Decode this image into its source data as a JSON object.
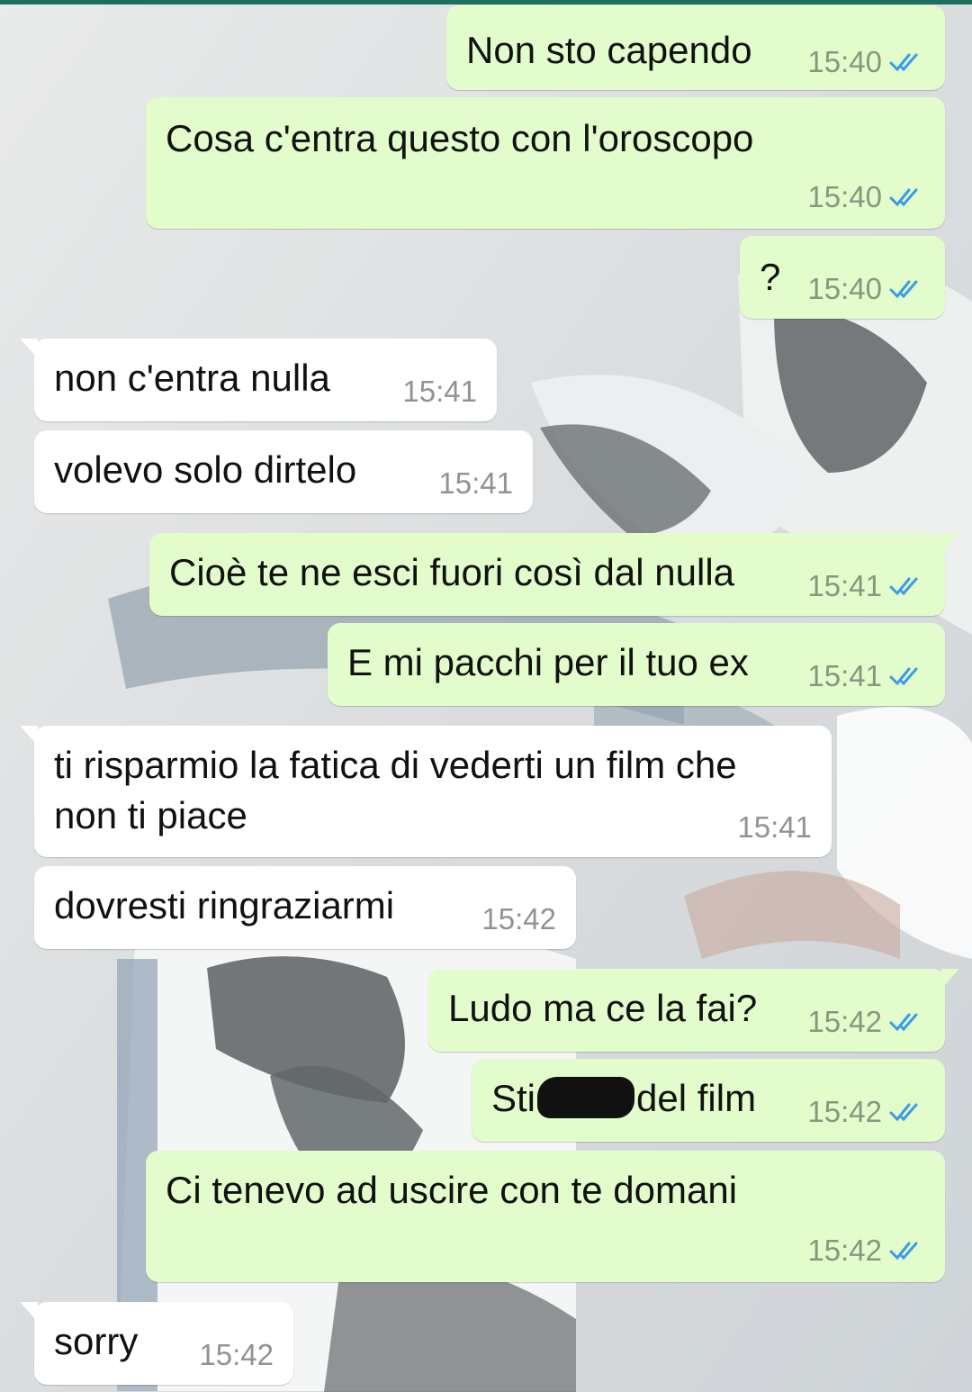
{
  "theme": {
    "outgoing_bubble": "#e2fdcb",
    "incoming_bubble": "#ffffff",
    "read_tick_color": "#3b9be8",
    "header_strip": "#1f6f5e"
  },
  "wallpaper": {
    "icon": "sneaker-photo-wallpaper"
  },
  "messages": [
    {
      "dir": "out",
      "text": "Non sto capendo",
      "time": "15:40",
      "status": "read"
    },
    {
      "dir": "out",
      "text": "Cosa c'entra questo con l'oroscopo",
      "time": "15:40",
      "status": "read"
    },
    {
      "dir": "out",
      "text": "?",
      "time": "15:40",
      "status": "read"
    },
    {
      "dir": "in",
      "text": "non c'entra nulla",
      "time": "15:41"
    },
    {
      "dir": "in",
      "text": "volevo solo dirtelo",
      "time": "15:41"
    },
    {
      "dir": "out",
      "text": "Cioè te ne esci fuori così dal nulla",
      "time": "15:41",
      "status": "read"
    },
    {
      "dir": "out",
      "text": "E mi pacchi per il tuo ex",
      "time": "15:41",
      "status": "read"
    },
    {
      "dir": "in",
      "line1": "ti risparmio la fatica di vederti un film che",
      "line2": "non ti piace",
      "time": "15:41"
    },
    {
      "dir": "in",
      "text": "dovresti ringraziarmi",
      "time": "15:42"
    },
    {
      "dir": "out",
      "text": "Ludo ma ce la fai?",
      "time": "15:42",
      "status": "read"
    },
    {
      "dir": "out",
      "text_before": "Sti",
      "text_after": "del film",
      "time": "15:42",
      "status": "read"
    },
    {
      "dir": "out",
      "text": "Ci tenevo ad uscire con te domani",
      "time": "15:42",
      "status": "read"
    },
    {
      "dir": "in",
      "text": "sorry",
      "time": "15:42"
    }
  ]
}
